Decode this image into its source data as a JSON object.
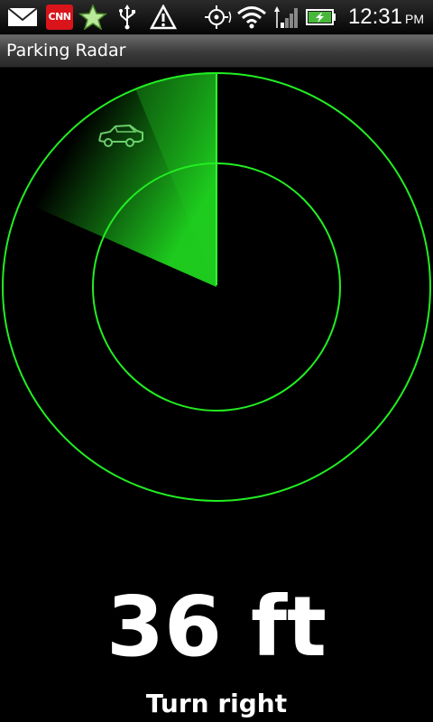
{
  "status_bar": {
    "icons": [
      "mail-icon",
      "cnn-icon",
      "star-icon",
      "usb-icon",
      "warning-icon",
      "gps-icon",
      "wifi-icon",
      "signal-icon",
      "battery-charging-icon"
    ],
    "cnn_label": "CNN",
    "time": "12:31",
    "ampm": "PM"
  },
  "title_bar": {
    "title": "Parking Radar"
  },
  "radar": {
    "color": "#22ee22",
    "target_icon": "car-icon"
  },
  "readout": {
    "distance": "36 ft",
    "instruction": "Turn right"
  }
}
